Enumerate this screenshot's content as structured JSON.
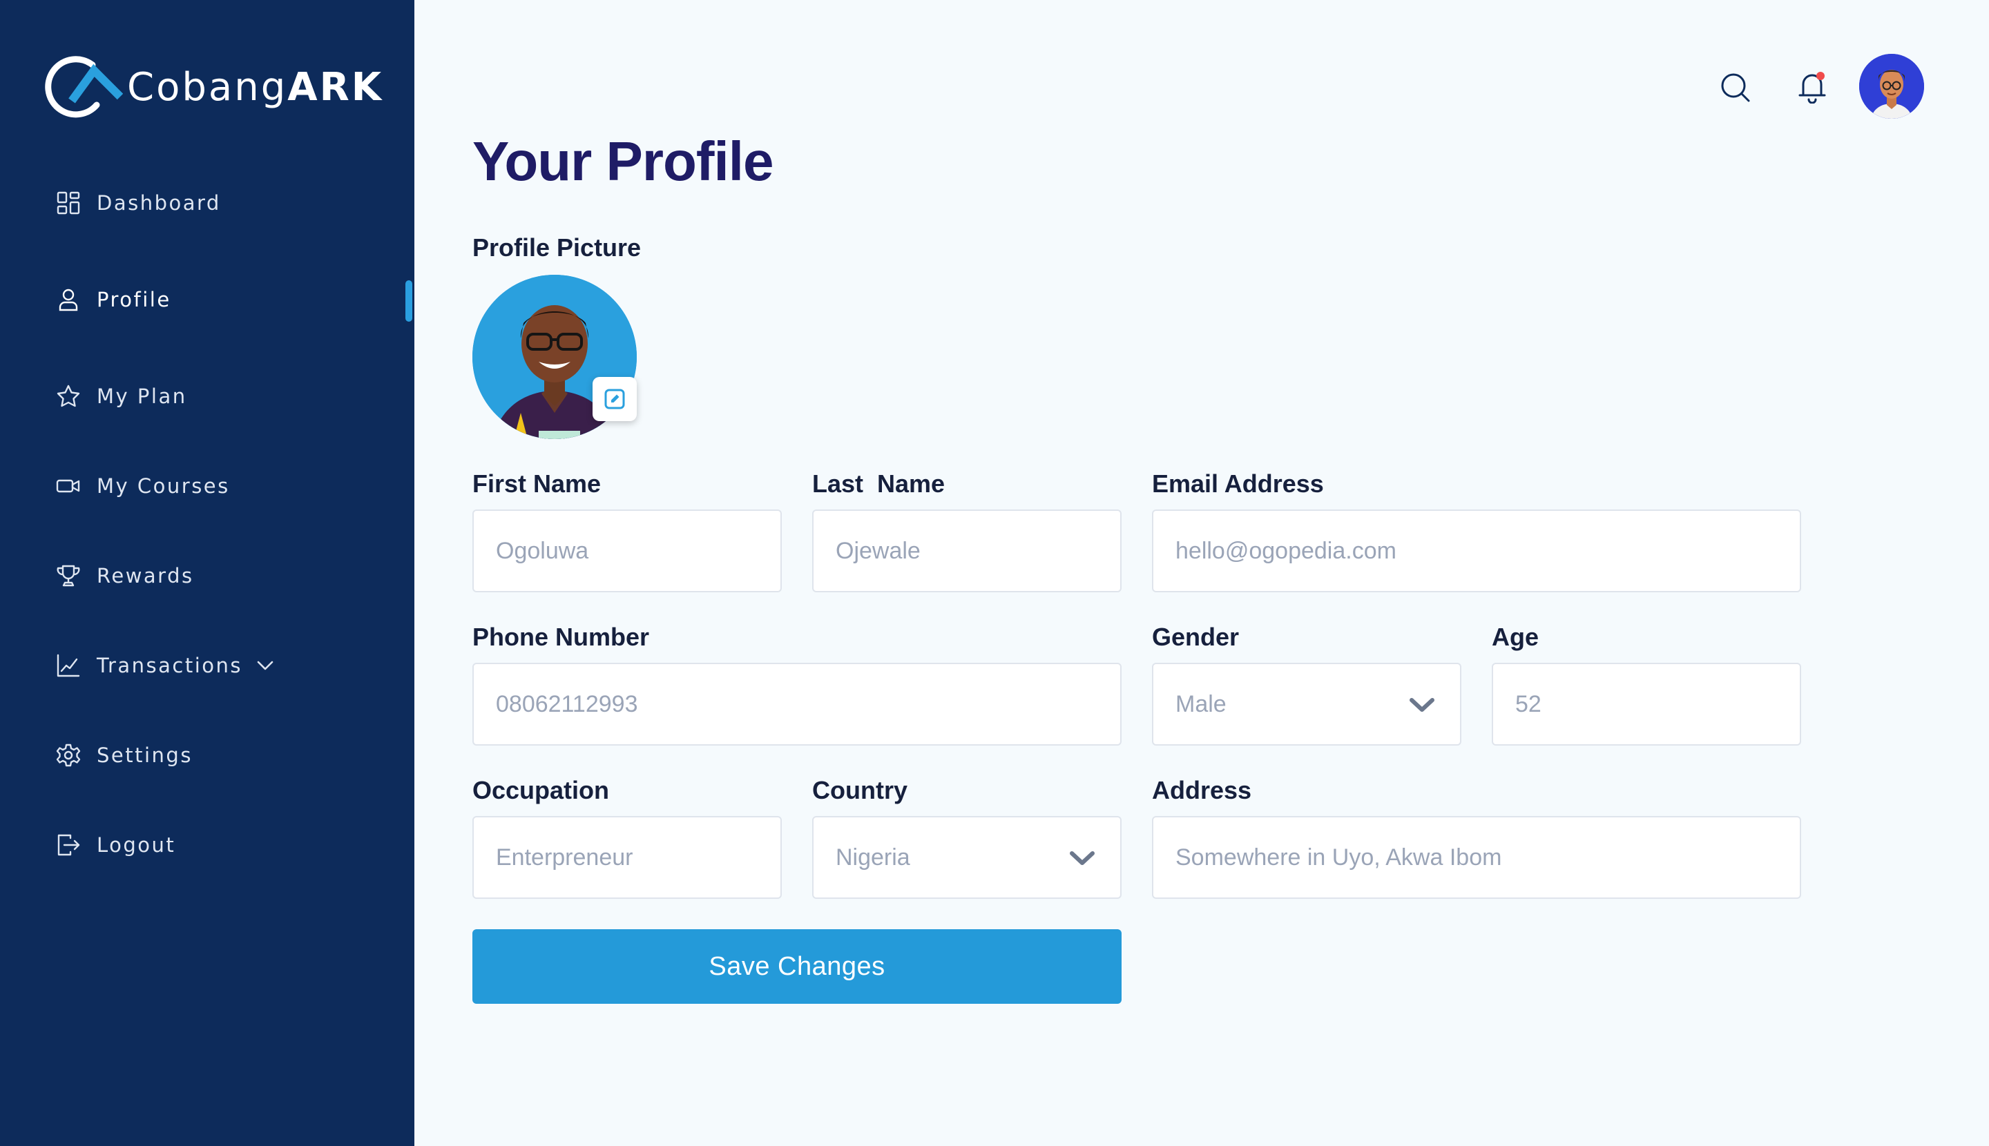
{
  "app": {
    "logo_text_regular": "Cobang",
    "logo_text_bold": "ARK"
  },
  "sidebar": {
    "items": [
      {
        "label": "Dashboard",
        "icon": "grid-icon"
      },
      {
        "label": "Profile",
        "icon": "user-icon",
        "active": true
      },
      {
        "label": "My Plan",
        "icon": "star-icon"
      },
      {
        "label": "My Courses",
        "icon": "video-icon"
      },
      {
        "label": "Rewards",
        "icon": "trophy-icon"
      },
      {
        "label": "Transactions",
        "icon": "chart-line-icon",
        "has_dropdown": true
      },
      {
        "label": "Settings",
        "icon": "gear-icon"
      },
      {
        "label": "Logout",
        "icon": "logout-icon"
      }
    ]
  },
  "header": {
    "icons": [
      "search-icon",
      "bell-icon",
      "user-avatar"
    ]
  },
  "main": {
    "title": "Your Profile",
    "profile_picture_label": "Profile Picture",
    "fields": {
      "first_name": {
        "label": "First Name",
        "value": "Ogoluwa"
      },
      "last_name": {
        "label": "Last  Name",
        "value": "Ojewale"
      },
      "email": {
        "label": "Email Address",
        "value": "hello@ogopedia.com"
      },
      "phone": {
        "label": "Phone Number",
        "value": "08062112993"
      },
      "gender": {
        "label": "Gender",
        "value": "Male"
      },
      "age": {
        "label": "Age",
        "value": "52"
      },
      "occupation": {
        "label": "Occupation",
        "value": "Enterpreneur"
      },
      "country": {
        "label": "Country",
        "value": "Nigeria"
      },
      "address": {
        "label": "Address",
        "value": "Somewhere in Uyo, Akwa Ibom"
      }
    },
    "save_label": "Save Changes"
  },
  "colors": {
    "sidebar_bg": "#0d2b5b",
    "accent": "#249ad9",
    "title": "#1f1c66",
    "notification_dot": "#f04b4b"
  }
}
